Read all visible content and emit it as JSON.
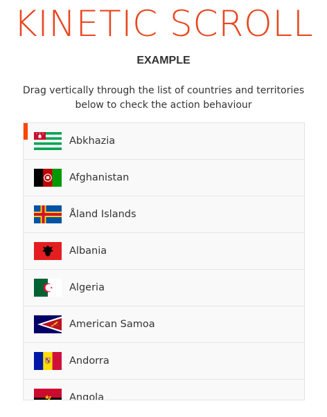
{
  "header": {
    "title": "KINETIC SCROLL",
    "subtitle": "EXAMPLE",
    "instructions": "Drag vertically through the list of countries and territories below to check the action behaviour"
  },
  "colors": {
    "accent": "#e8461e",
    "scroll_indicator": "#ff4500",
    "list_background": "#f9f9f9",
    "row_divider": "#e6e6e6"
  },
  "countries": [
    {
      "name": "Abkhazia",
      "flag_icon": "abkhazia-flag-icon"
    },
    {
      "name": "Afghanistan",
      "flag_icon": "afghanistan-flag-icon"
    },
    {
      "name": "Åland Islands",
      "flag_icon": "aland-islands-flag-icon"
    },
    {
      "name": "Albania",
      "flag_icon": "albania-flag-icon"
    },
    {
      "name": "Algeria",
      "flag_icon": "algeria-flag-icon"
    },
    {
      "name": "American Samoa",
      "flag_icon": "american-samoa-flag-icon"
    },
    {
      "name": "Andorra",
      "flag_icon": "andorra-flag-icon"
    },
    {
      "name": "Angola",
      "flag_icon": "angola-flag-icon"
    }
  ]
}
